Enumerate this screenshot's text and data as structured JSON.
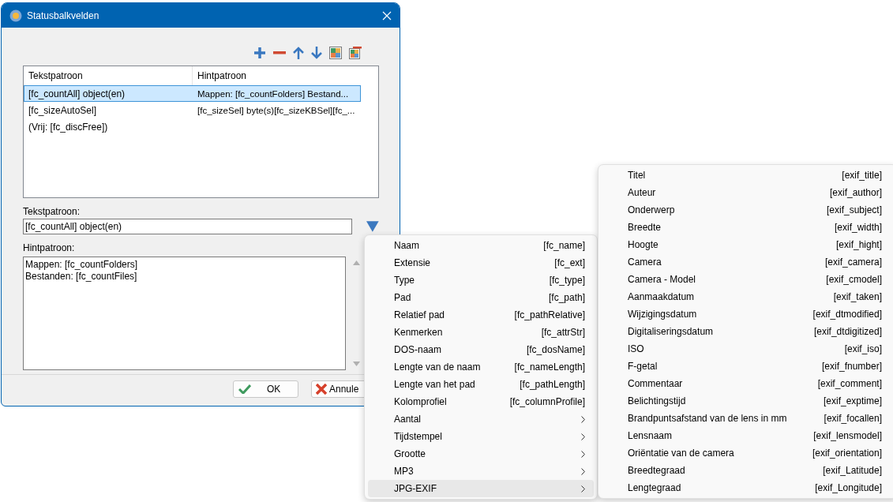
{
  "window": {
    "title": "Statusbalkvelden"
  },
  "table": {
    "columns": [
      "Tekstpatroon",
      "Hintpatroon"
    ],
    "rows": [
      {
        "cells": [
          "[fc_countAll] object(en)",
          "Mappen: [fc_countFolders] Bestand..."
        ],
        "selected": true
      },
      {
        "cells": [
          "[fc_sizeAutoSel]",
          "[fc_sizeSel] byte(s)[fc_sizeKBSel][fc_..."
        ],
        "selected": false
      },
      {
        "cells": [
          "(Vrij: [fc_discFree])",
          ""
        ],
        "selected": false
      }
    ]
  },
  "text_pattern": {
    "label": "Tekstpatroon:",
    "value": "[fc_countAll] object(en)"
  },
  "hint_pattern": {
    "label": "Hintpatroon:",
    "lines": [
      "Mappen: [fc_countFolders]",
      "Bestanden: [fc_countFiles]"
    ]
  },
  "buttons": [
    {
      "kind": "ok",
      "label": "OK"
    },
    {
      "kind": "cancel",
      "label": "Annule"
    }
  ],
  "menu": [
    {
      "kind": "field",
      "label": "Naam",
      "code": "[fc_name]",
      "selected": false
    },
    {
      "kind": "field",
      "label": "Extensie",
      "code": "[fc_ext]",
      "selected": false
    },
    {
      "kind": "field",
      "label": "Type",
      "code": "[fc_type]",
      "selected": false
    },
    {
      "kind": "field",
      "label": "Pad",
      "code": "[fc_path]",
      "selected": false
    },
    {
      "kind": "field",
      "label": "Relatief pad",
      "code": "[fc_pathRelative]",
      "selected": false
    },
    {
      "kind": "field",
      "label": "Kenmerken",
      "code": "[fc_attrStr]",
      "selected": false
    },
    {
      "kind": "field",
      "label": "DOS-naam",
      "code": "[fc_dosName]",
      "selected": false
    },
    {
      "kind": "field",
      "label": "Lengte van de naam",
      "code": "[fc_nameLength]",
      "selected": false
    },
    {
      "kind": "field",
      "label": "Lengte van het pad",
      "code": "[fc_pathLength]",
      "selected": false
    },
    {
      "kind": "field",
      "label": "Kolomprofiel",
      "code": "[fc_columnProfile]",
      "selected": false
    },
    {
      "kind": "submenu",
      "label": "Aantal",
      "selected": false
    },
    {
      "kind": "submenu",
      "label": "Tijdstempel",
      "selected": false
    },
    {
      "kind": "submenu",
      "label": "Grootte",
      "selected": false
    },
    {
      "kind": "submenu",
      "label": "MP3",
      "selected": false
    },
    {
      "kind": "submenu",
      "label": "JPG-EXIF",
      "selected": true
    }
  ],
  "submenu": [
    {
      "label": "Titel",
      "code": "[exif_title]"
    },
    {
      "label": "Auteur",
      "code": "[exif_author]"
    },
    {
      "label": "Onderwerp",
      "code": "[exif_subject]"
    },
    {
      "label": "Breedte",
      "code": "[exif_width]"
    },
    {
      "label": "Hoogte",
      "code": "[exif_hight]"
    },
    {
      "label": "Camera",
      "code": "[exif_camera]"
    },
    {
      "label": "Camera - Model",
      "code": "[exif_cmodel]"
    },
    {
      "label": "Aanmaakdatum",
      "code": "[exif_taken]"
    },
    {
      "label": "Wijzigingsdatum",
      "code": "[exif_dtmodified]"
    },
    {
      "label": "Digitaliseringsdatum",
      "code": "[exif_dtdigitized]"
    },
    {
      "label": "ISO",
      "code": "[exif_iso]"
    },
    {
      "label": "F-getal",
      "code": "[exif_fnumber]"
    },
    {
      "label": "Commentaar",
      "code": "[exif_comment]"
    },
    {
      "label": "Belichtingstijd",
      "code": "[exif_exptime]"
    },
    {
      "label": "Brandpuntsafstand van de lens in mm",
      "code": "[exif_focallen]"
    },
    {
      "label": "Lensnaam",
      "code": "[exif_lensmodel]"
    },
    {
      "label": "Oriëntatie van de camera",
      "code": "[exif_orientation]"
    },
    {
      "label": "Breedtegraad",
      "code": "[exif_Latitude]"
    },
    {
      "label": "Lengtegraad",
      "code": "[exif_Longitude]"
    }
  ]
}
